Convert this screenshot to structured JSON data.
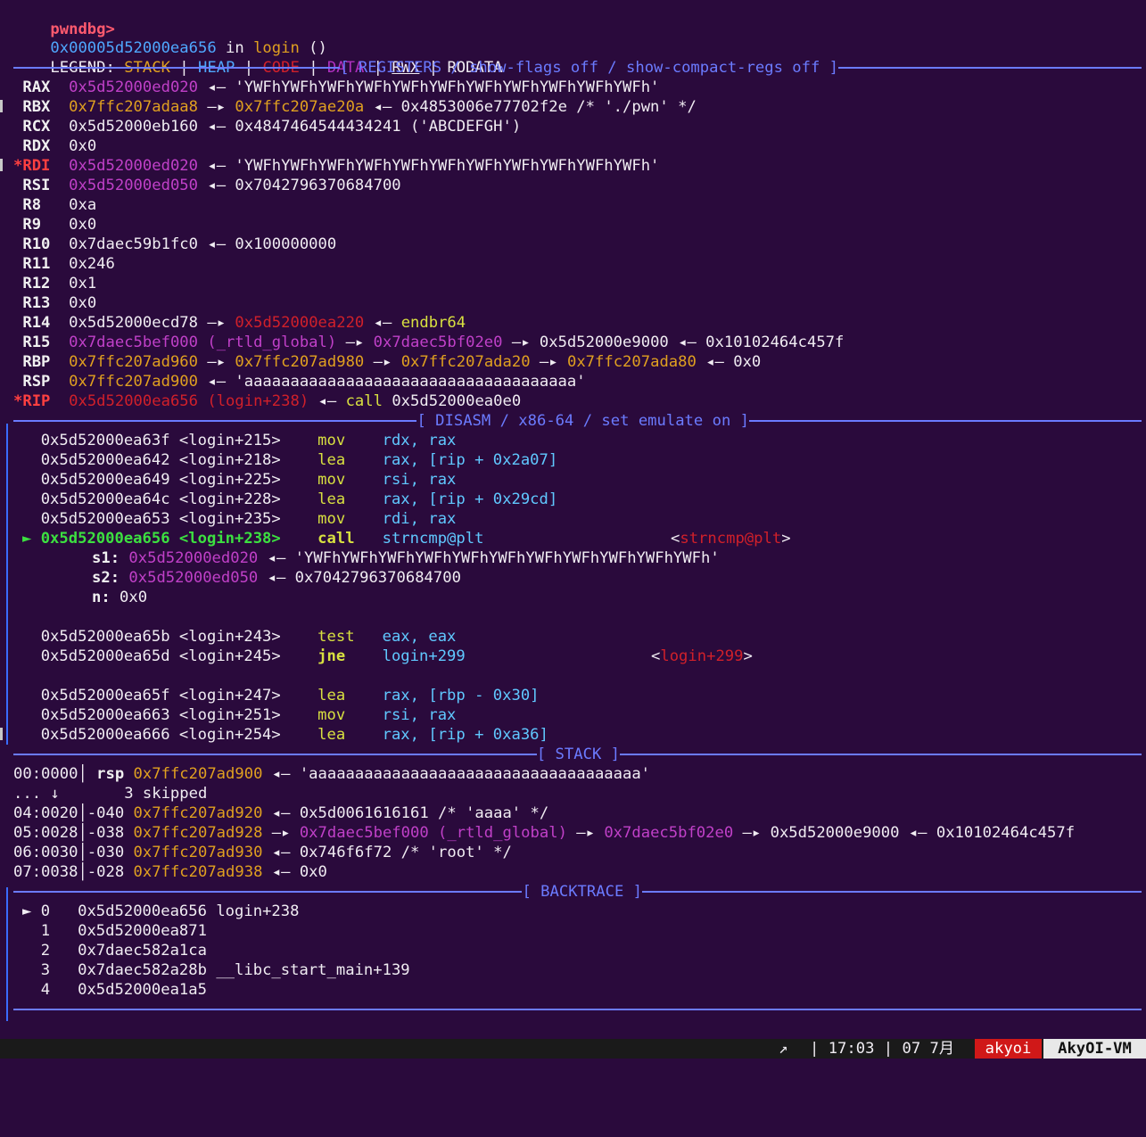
{
  "prompt": "pwndbg>",
  "top": {
    "addr": "0x00005d52000ea656",
    "in": " in ",
    "func": "login",
    "args": " ()"
  },
  "legend": {
    "label": "LEGEND: ",
    "stack": "STACK",
    "heap": "HEAP",
    "code": "CODE",
    "data": "DATA",
    "rwx": "RWX",
    "rodata": "RODATA",
    "sep": " | "
  },
  "headers": {
    "registers": "[ REGISTERS / show-flags off / show-compact-regs off ]",
    "disasm": "[ DISASM / x86-64 / set emulate on ]",
    "stack": "[ STACK ]",
    "backtrace": "[ BACKTRACE ]"
  },
  "registers": [
    {
      "name": "RAX",
      "star": "",
      "v1": "0x5d52000ed020",
      "v1c": "mag",
      "rest": " ◂— 'YWFhYWFhYWFhYWFhYWFhYWFhYWFhYWFhYWFhYWFhYWFh'"
    },
    {
      "name": "RBX",
      "star": "",
      "v1": "0x7ffc207adaa8",
      "v1c": "stack",
      "rest": " —▸ ",
      "v2": "0x7ffc207ae20a",
      "v2c": "stack",
      "rest2": " ◂— 0x4853006e77702f2e /* './pwn' */"
    },
    {
      "name": "RCX",
      "star": "",
      "v1": "0x5d52000eb160",
      "v1c": "white",
      "rest": " ◂— 0x4847464544434241 ('ABCDEFGH')"
    },
    {
      "name": "RDX",
      "star": "",
      "v1": "0x0",
      "v1c": "white",
      "rest": ""
    },
    {
      "name": "RDI",
      "star": "*",
      "v1": "0x5d52000ed020",
      "v1c": "mag",
      "rest": " ◂— 'YWFhYWFhYWFhYWFhYWFhYWFhYWFhYWFhYWFhYWFhYWFh'"
    },
    {
      "name": "RSI",
      "star": "",
      "v1": "0x5d52000ed050",
      "v1c": "mag",
      "rest": " ◂— 0x7042796370684700"
    },
    {
      "name": "R8",
      "star": "",
      "v1": "0xa",
      "v1c": "white",
      "rest": ""
    },
    {
      "name": "R9",
      "star": "",
      "v1": "0x0",
      "v1c": "white",
      "rest": ""
    },
    {
      "name": "R10",
      "star": "",
      "v1": "0x7daec59b1fc0",
      "v1c": "white",
      "rest": " ◂— 0x100000000"
    },
    {
      "name": "R11",
      "star": "",
      "v1": "0x246",
      "v1c": "white",
      "rest": ""
    },
    {
      "name": "R12",
      "star": "",
      "v1": "0x1",
      "v1c": "white",
      "rest": ""
    },
    {
      "name": "R13",
      "star": "",
      "v1": "0x0",
      "v1c": "white",
      "rest": ""
    },
    {
      "name": "R14",
      "star": "",
      "v1": "0x5d52000ecd78",
      "v1c": "white",
      "rest": " —▸ ",
      "v2": "0x5d52000ea220",
      "v2c": "code",
      "rest2": " ◂— ",
      "v3": "endbr64",
      "v3c": "yellow"
    },
    {
      "name": "R15",
      "star": "",
      "v1": "0x7daec5bef000 (_rtld_global)",
      "v1c": "mag",
      "rest": " —▸ ",
      "v2": "0x7daec5bf02e0",
      "v2c": "mag",
      "rest2": " —▸ 0x5d52000e9000 ◂— 0x10102464c457f"
    },
    {
      "name": "RBP",
      "star": "",
      "v1": "0x7ffc207ad960",
      "v1c": "stack",
      "rest": " —▸ ",
      "v2": "0x7ffc207ad980",
      "v2c": "stack",
      "rest2": " —▸ ",
      "v3": "0x7ffc207ada20",
      "v3c": "stack",
      "rest3": " —▸ ",
      "v4": "0x7ffc207ada80",
      "v4c": "stack",
      "rest4": " ◂— 0x0"
    },
    {
      "name": "RSP",
      "star": "",
      "v1": "0x7ffc207ad900",
      "v1c": "stack",
      "rest": " ◂— 'aaaaaaaaaaaaaaaaaaaaaaaaaaaaaaaaaaaa'"
    },
    {
      "name": "RIP",
      "star": "*",
      "v1": "0x5d52000ea656 (login+238)",
      "v1c": "code",
      "rest": " ◂— ",
      "v2": "call",
      "v2c": "yellow",
      "rest2": " 0x5d52000ea0e0"
    }
  ],
  "disasm": [
    {
      "addr": "0x5d52000ea63f",
      "sym": "<login+215>",
      "op": "mov",
      "a": "rdx, rax"
    },
    {
      "addr": "0x5d52000ea642",
      "sym": "<login+218>",
      "op": "lea",
      "a": "rax, [rip + 0x2a07]"
    },
    {
      "addr": "0x5d52000ea649",
      "sym": "<login+225>",
      "op": "mov",
      "a": "rsi, rax"
    },
    {
      "addr": "0x5d52000ea64c",
      "sym": "<login+228>",
      "op": "lea",
      "a": "rax, [rip + 0x29cd]"
    },
    {
      "addr": "0x5d52000ea653",
      "sym": "<login+235>",
      "op": "mov",
      "a": "rdi, rax"
    }
  ],
  "current": {
    "marker": "►",
    "addr": "0x5d52000ea656",
    "sym": "<login+238>",
    "op": "call",
    "a": "strncmp@plt",
    "target": "strncmp@plt"
  },
  "call_args": [
    {
      "k": "s1:",
      "v": "0x5d52000ed020",
      "rest": " ◂— 'YWFhYWFhYWFhYWFhYWFhYWFhYWFhYWFhYWFhYWFhYWFh'"
    },
    {
      "k": "s2:",
      "v": "0x5d52000ed050",
      "rest": " ◂— 0x7042796370684700"
    },
    {
      "k": "n:",
      "v": "0x0",
      "rest": ""
    }
  ],
  "disasm2": [
    {
      "addr": "0x5d52000ea65b",
      "sym": "<login+243>",
      "op": "test",
      "a": "eax, eax"
    },
    {
      "addr": "0x5d52000ea65d",
      "sym": "<login+245>",
      "op": "jne",
      "a": "login+299",
      "target": "login+299"
    }
  ],
  "disasm3": [
    {
      "addr": "0x5d52000ea65f",
      "sym": "<login+247>",
      "op": "lea",
      "a": "rax, [rbp - 0x30]"
    },
    {
      "addr": "0x5d52000ea663",
      "sym": "<login+251>",
      "op": "mov",
      "a": "rsi, rax"
    },
    {
      "addr": "0x5d52000ea666",
      "sym": "<login+254>",
      "op": "lea",
      "a": "rax, [rip + 0xa36]"
    }
  ],
  "stack": [
    {
      "idx": "00:0000",
      "off": " rsp ",
      "addr": "0x7ffc207ad900",
      "rest": " ◂— 'aaaaaaaaaaaaaaaaaaaaaaaaaaaaaaaaaaaa'"
    },
    {
      "idx": "04:0020",
      "off": "-040 ",
      "addr": "0x7ffc207ad920",
      "rest": " ◂— 0x5d0061616161 /* 'aaaa' */"
    },
    {
      "idx": "05:0028",
      "off": "-038 ",
      "addr": "0x7ffc207ad928",
      "rest": " —▸ ",
      "v2": "0x7daec5bef000 (_rtld_global)",
      "rest2": " —▸ ",
      "v3": "0x7daec5bf02e0",
      "rest3": " —▸ 0x5d52000e9000 ◂— 0x10102464c457f"
    },
    {
      "idx": "06:0030",
      "off": "-030 ",
      "addr": "0x7ffc207ad930",
      "rest": " ◂— 0x746f6f72 /* 'root' */"
    },
    {
      "idx": "07:0038",
      "off": "-028 ",
      "addr": "0x7ffc207ad938",
      "rest": " ◂— 0x0"
    }
  ],
  "skipped": {
    "dots": "... ↓",
    "text": "3 skipped"
  },
  "backtrace": [
    {
      "mark": "►",
      "n": "0",
      "addr": "0x5d52000ea656",
      "sym": "login+238"
    },
    {
      "mark": "",
      "n": "1",
      "addr": "0x5d52000ea871",
      "sym": ""
    },
    {
      "mark": "",
      "n": "2",
      "addr": "0x7daec582a1ca",
      "sym": ""
    },
    {
      "mark": "",
      "n": "3",
      "addr": "0x7daec582a28b",
      "sym": "__libc_start_main+139"
    },
    {
      "mark": "",
      "n": "4",
      "addr": "0x5d52000ea1a5",
      "sym": ""
    }
  ],
  "statusbar": {
    "arrow": "↗",
    "time": "| 17:03 | 07 7月",
    "user": "akyoi",
    "host": "AkyOI-VM",
    "user_bg": "#d01818",
    "host_bg": "#e8e8e8"
  }
}
